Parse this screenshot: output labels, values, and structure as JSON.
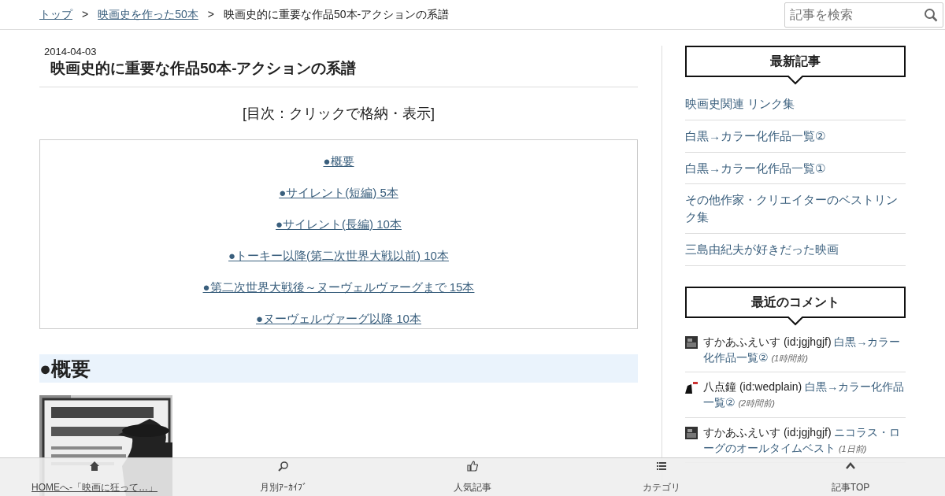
{
  "breadcrumb": [
    {
      "label": "トップ",
      "link": true
    },
    {
      "label": "映画史を作った50本",
      "link": true
    },
    {
      "label": "映画史的に重要な作品50本-アクションの系譜",
      "link": false
    }
  ],
  "breadcrumb_separator": ">",
  "search": {
    "placeholder": "記事を検索"
  },
  "article": {
    "date": "2014-04-03",
    "title": "映画史的に重要な作品50本-アクションの系譜",
    "toc": {
      "heading": "[目次：クリックで格納・表示]",
      "items": [
        "●概要",
        "●サイレント(短編) 5本",
        "●サイレント(長編) 10本",
        "●トーキー以降(第二次世界大戦以前) 10本",
        "●第二次世界大戦後～ヌーヴェルヴァーグまで 15本",
        "●ヌーヴェルヴァーグ以降 10本"
      ]
    },
    "section_heading": "●概要"
  },
  "sidebar": {
    "recent": {
      "title": "最新記事",
      "items": [
        "映画史関連 リンク集",
        "白黒→カラー化作品一覧②",
        "白黒→カラー化作品一覧①",
        "その他作家・クリエイターのベストリンク集",
        "三島由紀夫が好きだった映画"
      ]
    },
    "comments": {
      "title": "最近のコメント",
      "items": [
        {
          "user": "すかあふえいす (id:jgjhgjf)",
          "article": "白黒→カラー化作品一覧②",
          "time": "(1時間前)"
        },
        {
          "user": "八点鐘 (id:wedplain)",
          "article": "白黒→カラー化作品一覧②",
          "time": "(2時間前)"
        },
        {
          "user": "すかあふえいす (id:jgjhgjf)",
          "article": "ニコラス・ローグのオールタイムベスト",
          "time": "(1日前)"
        }
      ]
    }
  },
  "bottom_nav": [
    {
      "label": "HOMEへ-「映画に狂って…」",
      "link": true
    },
    {
      "label": "月別ｱｰｶｲﾌﾞ",
      "link": false
    },
    {
      "label": "人気記事",
      "link": false
    },
    {
      "label": "カテゴリ",
      "link": false
    },
    {
      "label": "記事TOP",
      "link": false
    }
  ]
}
